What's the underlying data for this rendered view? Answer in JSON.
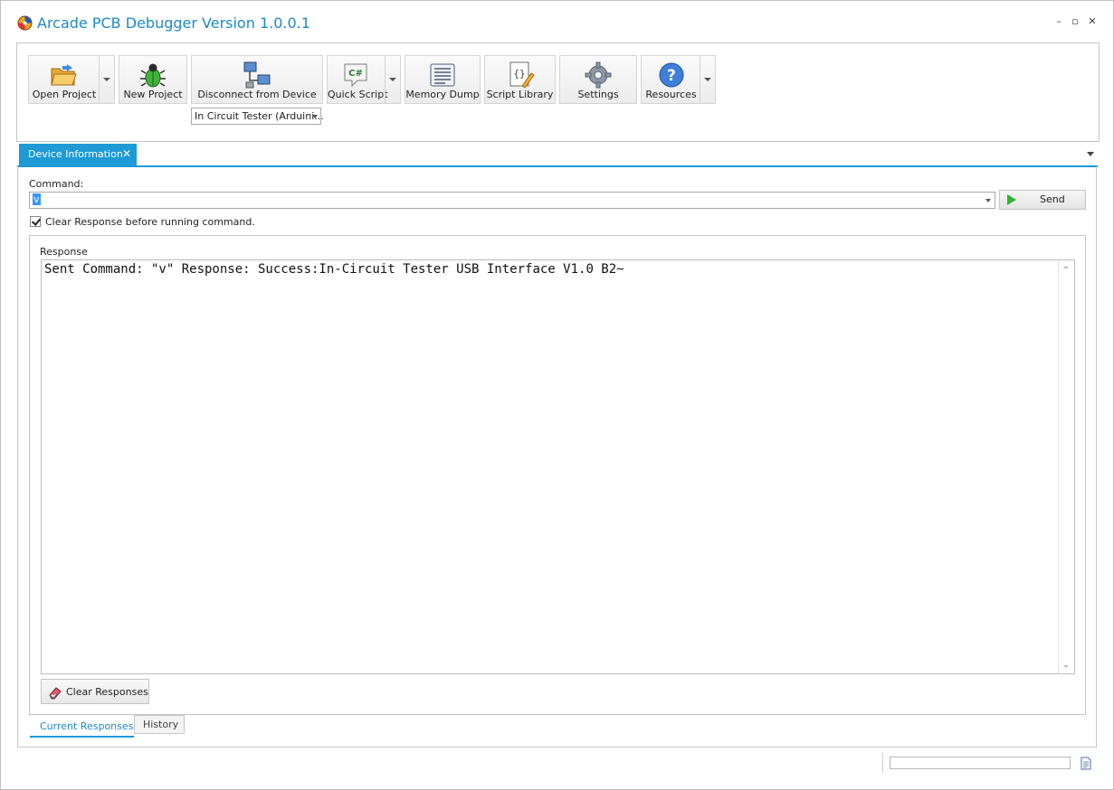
{
  "window": {
    "title": "Arcade PCB Debugger Version 1.0.0.1",
    "controls": {
      "minimize": "–",
      "maximize": "▫",
      "close": "✕"
    }
  },
  "toolbar": {
    "open_project": "Open Project",
    "new_project": "New Project",
    "disconnect": "Disconnect from Device",
    "quick_script": "Quick Script",
    "memory_dump": "Memory Dump",
    "script_library": "Script Library",
    "settings": "Settings",
    "resources": "Resources",
    "device_select": "In Circuit Tester (Arduini..."
  },
  "tabs": {
    "device_information": "Device Information",
    "close_glyph": "✕"
  },
  "command": {
    "label": "Command:",
    "value": "v",
    "send_label": "Send",
    "clear_before_label": "Clear Response before running command.",
    "clear_before_checked": true
  },
  "response": {
    "group_label": "Response",
    "text": "Sent Command: \"v\" Response: Success:In-Circuit Tester USB Interface V1.0 B2~",
    "clear_button": "Clear Responses"
  },
  "bottom_tabs": {
    "current": "Current Responses",
    "history": "History"
  },
  "statusbar": {
    "progress": 0
  },
  "colors": {
    "accent": "#1e9ad6",
    "title_text": "#1e88c7",
    "send_icon": "#2fb52f"
  },
  "icons": {
    "app": "arcade-logo-icon",
    "open_project": "folder-open-icon",
    "new_project": "bug-icon",
    "disconnect": "network-computers-icon",
    "quick_script": "csharp-icon",
    "memory_dump": "memory-list-icon",
    "script_library": "script-braces-icon",
    "settings": "gear-icon",
    "resources": "help-icon",
    "send": "play-icon",
    "clear": "eraser-icon",
    "status_doc": "document-icon"
  }
}
